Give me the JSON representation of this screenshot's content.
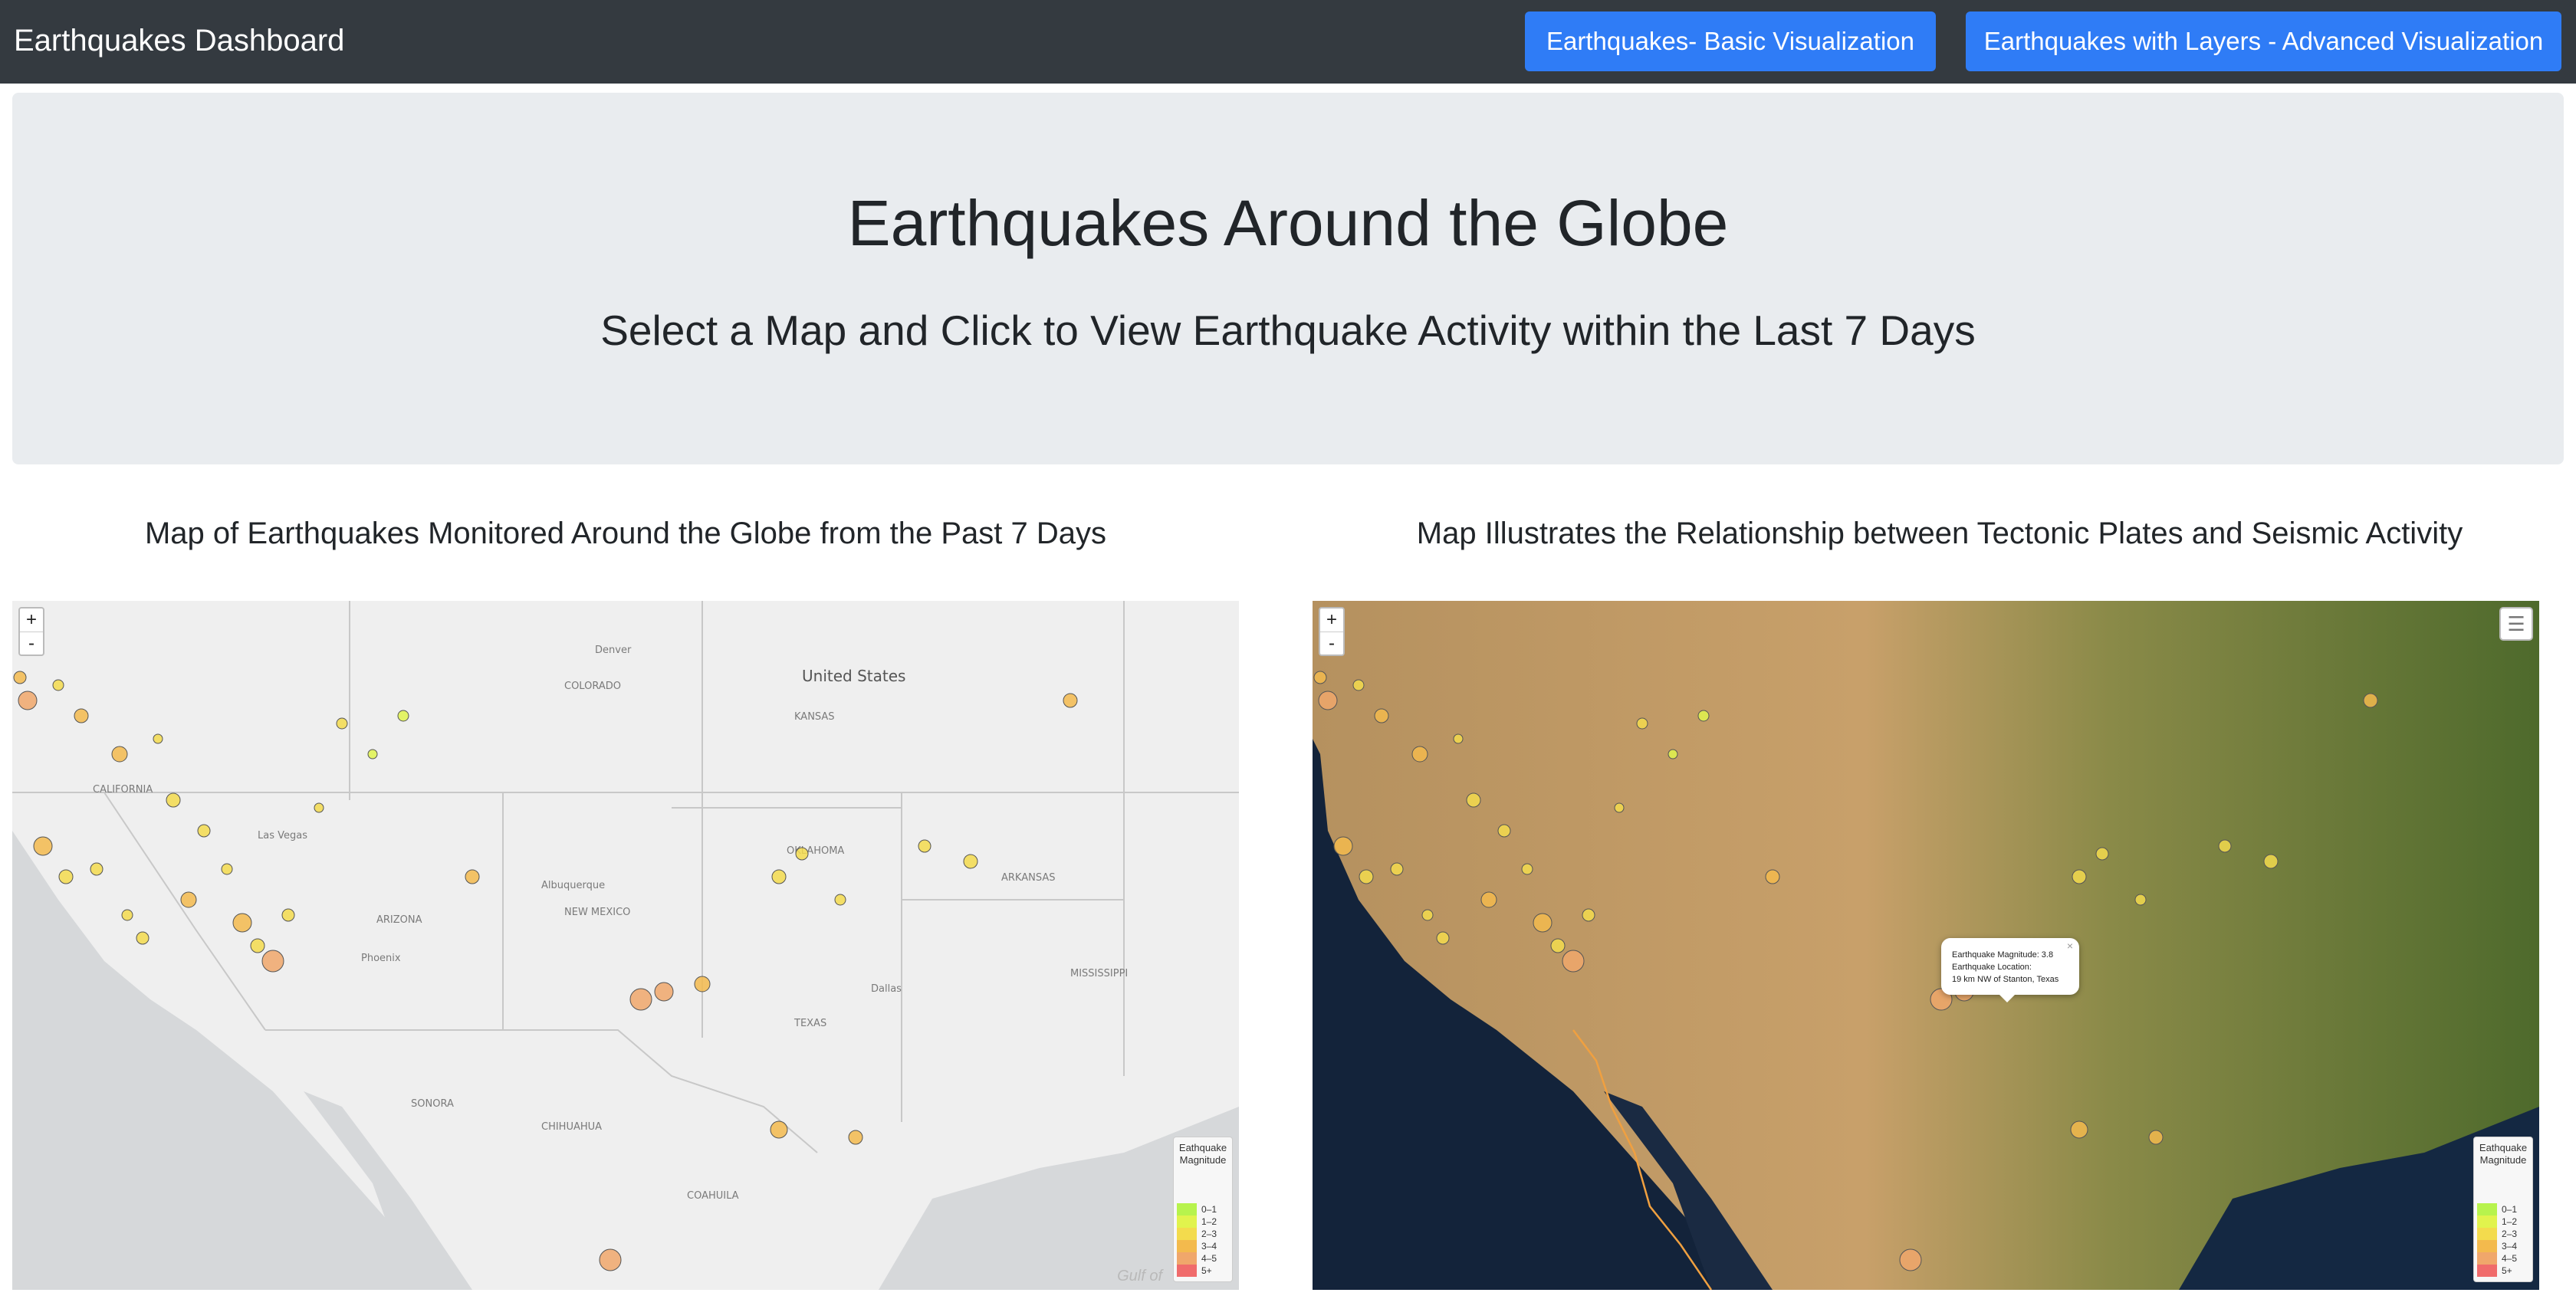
{
  "navbar": {
    "brand": "Earthquakes Dashboard",
    "basic_button": "Earthquakes- Basic Visualization",
    "advanced_button": "Earthquakes with Layers - Advanced Visualization"
  },
  "jumbotron": {
    "title": "Earthquakes Around the Globe",
    "subtitle": "Select a Map and Click to View Earthquake Activity within the Last 7 Days"
  },
  "map_left": {
    "title": "Map of Earthquakes Monitored Around the Globe from the Past 7 Days",
    "zoom_in": "+",
    "zoom_out": "-",
    "place_labels": [
      "United States",
      "CALIFORNIA",
      "ARIZONA",
      "NEW MEXICO",
      "TEXAS",
      "SONORA",
      "CHIHUAHUA",
      "COAHUILA",
      "KANSAS",
      "OKLAHOMA",
      "ARKANSAS",
      "MISSISSIPPI",
      "COLORADO",
      "Denver",
      "Dallas",
      "Phoenix",
      "Las Vegas",
      "Albuquerque",
      "Gulf of"
    ],
    "legend_title": "Eathquake Magnitude"
  },
  "map_right": {
    "title": "Map Illustrates the Relationship between Tectonic Plates and Seismic Activity",
    "zoom_in": "+",
    "zoom_out": "-",
    "layers_icon": "layers-icon",
    "legend_title": "Eathquake Magnitude",
    "popup": {
      "line1": "Earthquake Magnitude: 3.8",
      "line2": "Earthquake Location:",
      "line3": "19 km NW of Stanton, Texas",
      "close": "×"
    }
  },
  "legend": {
    "items": [
      {
        "label": "0–1",
        "color": "#b7f34d"
      },
      {
        "label": "1–2",
        "color": "#e1f34d"
      },
      {
        "label": "2–3",
        "color": "#f3db4d"
      },
      {
        "label": "3–4",
        "color": "#f3ba4d"
      },
      {
        "label": "4–5",
        "color": "#f0a76b"
      },
      {
        "label": "5+",
        "color": "#f06b6b"
      }
    ]
  },
  "colors": {
    "navbar_bg": "#343a40",
    "button_bg": "#2f7cf6",
    "jumbotron_bg": "#e9ecef"
  }
}
